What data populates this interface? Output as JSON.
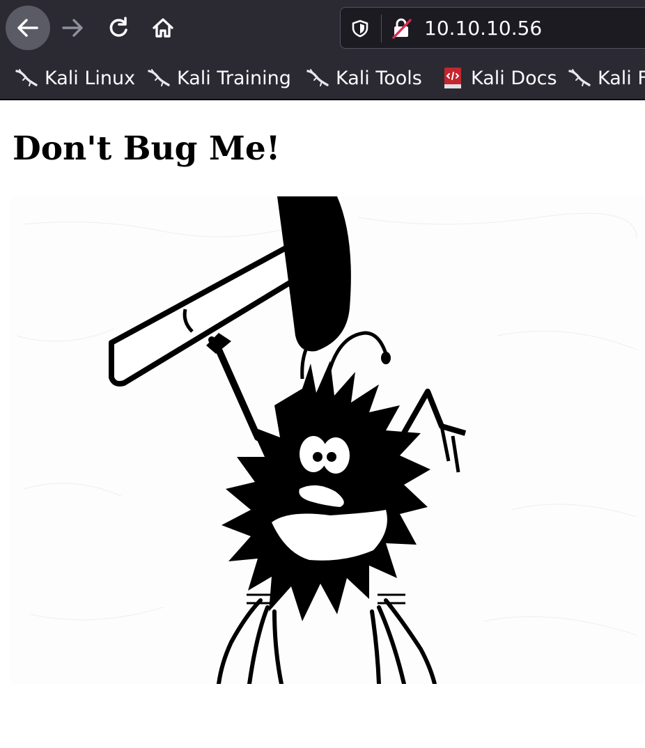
{
  "browser": {
    "url": "10.10.10.56",
    "icons": {
      "back": "arrow-left-icon",
      "forward": "arrow-right-icon",
      "reload": "reload-icon",
      "home": "home-icon",
      "shield": "shield-icon",
      "insecure": "insecure-lock-icon"
    }
  },
  "bookmarks": [
    {
      "label": "Kali Linux",
      "icon": "kali-dragon-icon"
    },
    {
      "label": "Kali Training",
      "icon": "kali-dragon-icon"
    },
    {
      "label": "Kali Tools",
      "icon": "kali-dragon-icon"
    },
    {
      "label": "Kali Docs",
      "icon": "docs-book-icon"
    },
    {
      "label": "Kali F",
      "icon": "kali-dragon-icon"
    }
  ],
  "page": {
    "heading": "Don't Bug Me!",
    "image": "bug-with-hammer-illustration"
  },
  "colors": {
    "toolbar": "#2b2a33",
    "urlbar": "#1c1b22",
    "text_light": "#fbfbfe",
    "page_bg": "#ffffff"
  }
}
